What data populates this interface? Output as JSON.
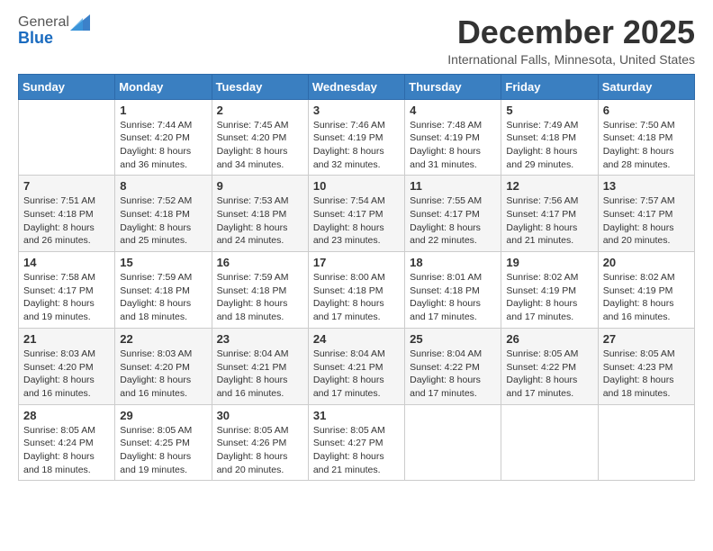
{
  "header": {
    "logo_general": "General",
    "logo_blue": "Blue",
    "month": "December 2025",
    "location": "International Falls, Minnesota, United States"
  },
  "days_of_week": [
    "Sunday",
    "Monday",
    "Tuesday",
    "Wednesday",
    "Thursday",
    "Friday",
    "Saturday"
  ],
  "weeks": [
    [
      {
        "day": "",
        "info": ""
      },
      {
        "day": "1",
        "info": "Sunrise: 7:44 AM\nSunset: 4:20 PM\nDaylight: 8 hours\nand 36 minutes."
      },
      {
        "day": "2",
        "info": "Sunrise: 7:45 AM\nSunset: 4:20 PM\nDaylight: 8 hours\nand 34 minutes."
      },
      {
        "day": "3",
        "info": "Sunrise: 7:46 AM\nSunset: 4:19 PM\nDaylight: 8 hours\nand 32 minutes."
      },
      {
        "day": "4",
        "info": "Sunrise: 7:48 AM\nSunset: 4:19 PM\nDaylight: 8 hours\nand 31 minutes."
      },
      {
        "day": "5",
        "info": "Sunrise: 7:49 AM\nSunset: 4:18 PM\nDaylight: 8 hours\nand 29 minutes."
      },
      {
        "day": "6",
        "info": "Sunrise: 7:50 AM\nSunset: 4:18 PM\nDaylight: 8 hours\nand 28 minutes."
      }
    ],
    [
      {
        "day": "7",
        "info": "Sunrise: 7:51 AM\nSunset: 4:18 PM\nDaylight: 8 hours\nand 26 minutes."
      },
      {
        "day": "8",
        "info": "Sunrise: 7:52 AM\nSunset: 4:18 PM\nDaylight: 8 hours\nand 25 minutes."
      },
      {
        "day": "9",
        "info": "Sunrise: 7:53 AM\nSunset: 4:18 PM\nDaylight: 8 hours\nand 24 minutes."
      },
      {
        "day": "10",
        "info": "Sunrise: 7:54 AM\nSunset: 4:17 PM\nDaylight: 8 hours\nand 23 minutes."
      },
      {
        "day": "11",
        "info": "Sunrise: 7:55 AM\nSunset: 4:17 PM\nDaylight: 8 hours\nand 22 minutes."
      },
      {
        "day": "12",
        "info": "Sunrise: 7:56 AM\nSunset: 4:17 PM\nDaylight: 8 hours\nand 21 minutes."
      },
      {
        "day": "13",
        "info": "Sunrise: 7:57 AM\nSunset: 4:17 PM\nDaylight: 8 hours\nand 20 minutes."
      }
    ],
    [
      {
        "day": "14",
        "info": "Sunrise: 7:58 AM\nSunset: 4:17 PM\nDaylight: 8 hours\nand 19 minutes."
      },
      {
        "day": "15",
        "info": "Sunrise: 7:59 AM\nSunset: 4:18 PM\nDaylight: 8 hours\nand 18 minutes."
      },
      {
        "day": "16",
        "info": "Sunrise: 7:59 AM\nSunset: 4:18 PM\nDaylight: 8 hours\nand 18 minutes."
      },
      {
        "day": "17",
        "info": "Sunrise: 8:00 AM\nSunset: 4:18 PM\nDaylight: 8 hours\nand 17 minutes."
      },
      {
        "day": "18",
        "info": "Sunrise: 8:01 AM\nSunset: 4:18 PM\nDaylight: 8 hours\nand 17 minutes."
      },
      {
        "day": "19",
        "info": "Sunrise: 8:02 AM\nSunset: 4:19 PM\nDaylight: 8 hours\nand 17 minutes."
      },
      {
        "day": "20",
        "info": "Sunrise: 8:02 AM\nSunset: 4:19 PM\nDaylight: 8 hours\nand 16 minutes."
      }
    ],
    [
      {
        "day": "21",
        "info": "Sunrise: 8:03 AM\nSunset: 4:20 PM\nDaylight: 8 hours\nand 16 minutes."
      },
      {
        "day": "22",
        "info": "Sunrise: 8:03 AM\nSunset: 4:20 PM\nDaylight: 8 hours\nand 16 minutes."
      },
      {
        "day": "23",
        "info": "Sunrise: 8:04 AM\nSunset: 4:21 PM\nDaylight: 8 hours\nand 16 minutes."
      },
      {
        "day": "24",
        "info": "Sunrise: 8:04 AM\nSunset: 4:21 PM\nDaylight: 8 hours\nand 17 minutes."
      },
      {
        "day": "25",
        "info": "Sunrise: 8:04 AM\nSunset: 4:22 PM\nDaylight: 8 hours\nand 17 minutes."
      },
      {
        "day": "26",
        "info": "Sunrise: 8:05 AM\nSunset: 4:22 PM\nDaylight: 8 hours\nand 17 minutes."
      },
      {
        "day": "27",
        "info": "Sunrise: 8:05 AM\nSunset: 4:23 PM\nDaylight: 8 hours\nand 18 minutes."
      }
    ],
    [
      {
        "day": "28",
        "info": "Sunrise: 8:05 AM\nSunset: 4:24 PM\nDaylight: 8 hours\nand 18 minutes."
      },
      {
        "day": "29",
        "info": "Sunrise: 8:05 AM\nSunset: 4:25 PM\nDaylight: 8 hours\nand 19 minutes."
      },
      {
        "day": "30",
        "info": "Sunrise: 8:05 AM\nSunset: 4:26 PM\nDaylight: 8 hours\nand 20 minutes."
      },
      {
        "day": "31",
        "info": "Sunrise: 8:05 AM\nSunset: 4:27 PM\nDaylight: 8 hours\nand 21 minutes."
      },
      {
        "day": "",
        "info": ""
      },
      {
        "day": "",
        "info": ""
      },
      {
        "day": "",
        "info": ""
      }
    ]
  ]
}
